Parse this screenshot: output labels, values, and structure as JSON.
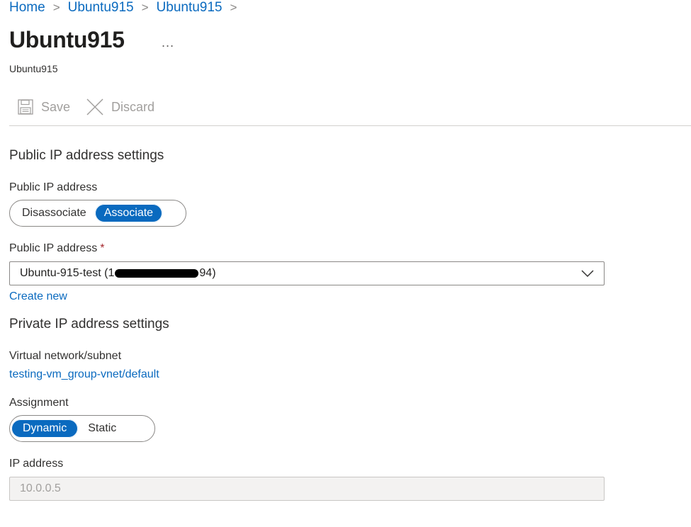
{
  "breadcrumb": [
    "Home",
    "Ubuntu915",
    "Ubuntu915"
  ],
  "breadcrumb_separator": ">",
  "title": "Ubuntu915",
  "more_label": "...",
  "subtitle": "Ubuntu915",
  "toolbar": {
    "save_label": "Save",
    "discard_label": "Discard"
  },
  "public_ip_settings": {
    "heading": "Public IP address settings",
    "toggle_label": "Public IP address",
    "toggle_options": [
      "Disassociate",
      "Associate"
    ],
    "toggle_selected": "Associate",
    "select_label": "Public IP address",
    "required_mark": "*",
    "select_value_prefix": "Ubuntu-915-test (1",
    "select_value_suffix": "94)",
    "create_new_label": "Create new"
  },
  "private_ip_settings": {
    "heading": "Private IP address settings",
    "vnet_label": "Virtual network/subnet",
    "vnet_value": "testing-vm_group-vnet/default",
    "assignment_label": "Assignment",
    "assignment_options": [
      "Dynamic",
      "Static"
    ],
    "assignment_selected": "Dynamic",
    "ip_label": "IP address",
    "ip_value": "10.0.0.5"
  },
  "colors": {
    "accent": "#0a6abf",
    "required": "#a4262c",
    "disabled_text": "#a19f9d"
  }
}
